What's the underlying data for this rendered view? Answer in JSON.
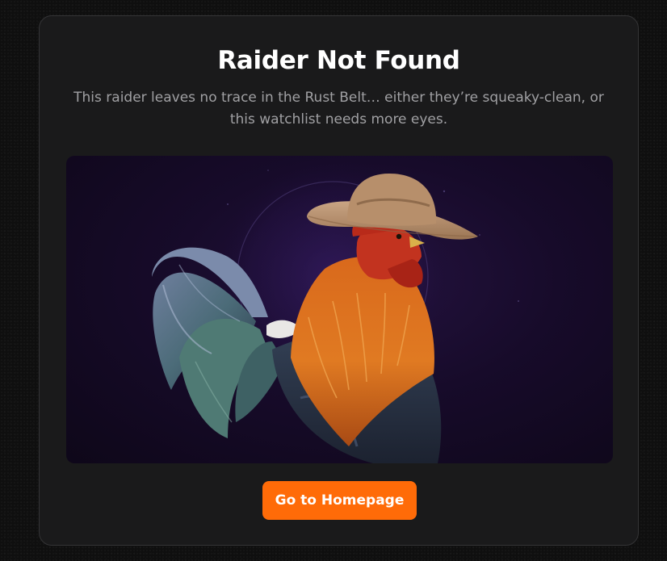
{
  "page": {
    "title": "Raider Not Found",
    "description": "This raider leaves no trace in the Rust Belt… either they’re squeaky-clean, or this watchlist needs more eyes."
  },
  "hero": {
    "icon": "rooster-cowboy-hat-illustration"
  },
  "actions": {
    "home_label": "Go to Homepage"
  },
  "colors": {
    "accent": "#ff6b08",
    "card_background": "#1a1a1b",
    "page_background": "#0f0f0f",
    "hero_background": "#170b2a"
  }
}
